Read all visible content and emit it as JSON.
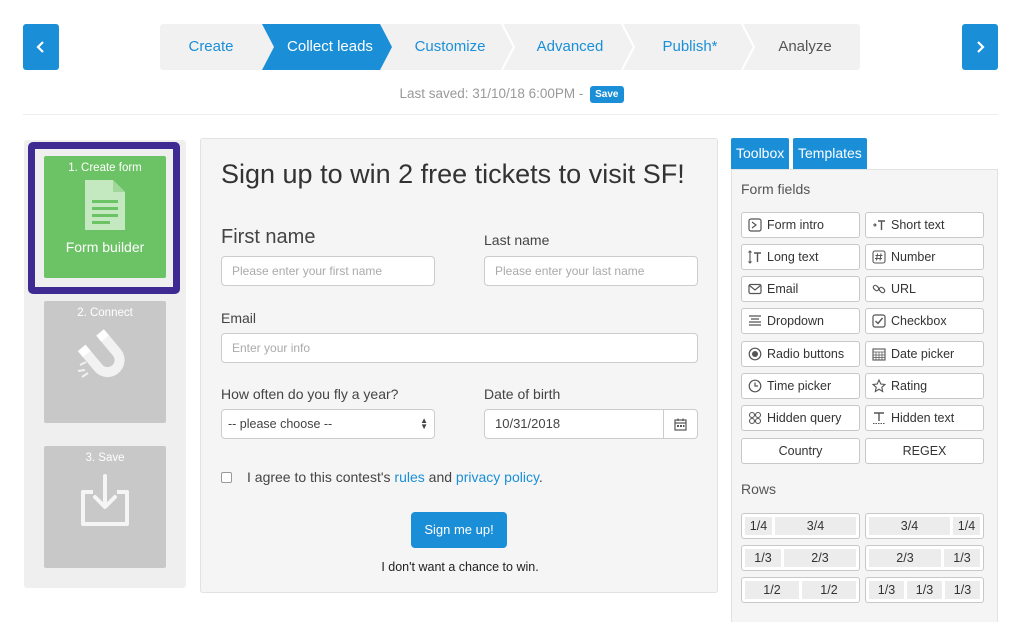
{
  "wizard": {
    "steps": [
      {
        "label": "Create",
        "state": "done"
      },
      {
        "label": "Collect leads",
        "state": "active"
      },
      {
        "label": "Customize",
        "state": "done"
      },
      {
        "label": "Advanced",
        "state": "done"
      },
      {
        "label": "Publish*",
        "state": "done"
      },
      {
        "label": "Analyze",
        "state": "disabled"
      }
    ],
    "prev_icon": "chevron-left-icon",
    "next_icon": "chevron-right-icon"
  },
  "status": {
    "last_saved": "Last saved: 31/10/18 6:00PM",
    "separator": "-",
    "save_label": "Save"
  },
  "sidebar": {
    "tiles": [
      {
        "number": "1. Create form",
        "name": "Form builder",
        "icon": "document-icon",
        "active": true
      },
      {
        "number": "2. Connect",
        "icon": "magnet-icon",
        "active": false
      },
      {
        "number": "3. Save",
        "icon": "save-icon",
        "active": false
      }
    ]
  },
  "form": {
    "title": "Sign up to win 2 free tickets to visit SF!",
    "first_name": {
      "label": "First name",
      "placeholder": "Please enter your first name"
    },
    "last_name": {
      "label": "Last name",
      "placeholder": "Please enter your last name"
    },
    "email": {
      "label": "Email",
      "placeholder": "Enter your info"
    },
    "fly": {
      "label": "How often do you fly a year?",
      "value": "-- please choose --"
    },
    "dob": {
      "label": "Date of birth",
      "value": "10/31/2018"
    },
    "agree": {
      "before": "I agree to this contest's ",
      "rules": "rules",
      "and": " and ",
      "privacy": "privacy policy",
      "after": "."
    },
    "submit_label": "Sign me up!",
    "decline_label": "I don't want a chance to win."
  },
  "toolbox": {
    "tabs": [
      "Toolbox",
      "Templates"
    ],
    "form_fields_title": "Form fields",
    "fields": [
      {
        "label": "Form intro",
        "icon": "form-intro-icon"
      },
      {
        "label": "Short text",
        "icon": "short-text-icon"
      },
      {
        "label": "Long text",
        "icon": "long-text-icon"
      },
      {
        "label": "Number",
        "icon": "number-icon"
      },
      {
        "label": "Email",
        "icon": "email-icon"
      },
      {
        "label": "URL",
        "icon": "link-icon"
      },
      {
        "label": "Dropdown",
        "icon": "dropdown-icon"
      },
      {
        "label": "Checkbox",
        "icon": "checkbox-icon"
      },
      {
        "label": "Radio buttons",
        "icon": "radio-icon"
      },
      {
        "label": "Date picker",
        "icon": "calendar-icon"
      },
      {
        "label": "Time picker",
        "icon": "clock-icon"
      },
      {
        "label": "Rating",
        "icon": "star-icon"
      },
      {
        "label": "Hidden query",
        "icon": "hidden-query-icon"
      },
      {
        "label": "Hidden text",
        "icon": "hidden-text-icon"
      },
      {
        "label": "Country",
        "icon": ""
      },
      {
        "label": "REGEX",
        "icon": ""
      }
    ],
    "rows_title": "Rows",
    "rows": [
      [
        "1/4",
        "3/4"
      ],
      [
        "3/4",
        "1/4"
      ],
      [
        "1/3",
        "2/3"
      ],
      [
        "2/3",
        "1/3"
      ],
      [
        "1/2",
        "1/2"
      ],
      [
        "1/3",
        "1/3",
        "1/3"
      ]
    ]
  },
  "colors": {
    "accent": "#1a8fd8",
    "active_tile": "#6bc365",
    "inactive_tile": "#c8c8c8",
    "highlight_frame": "#3f2a93"
  }
}
